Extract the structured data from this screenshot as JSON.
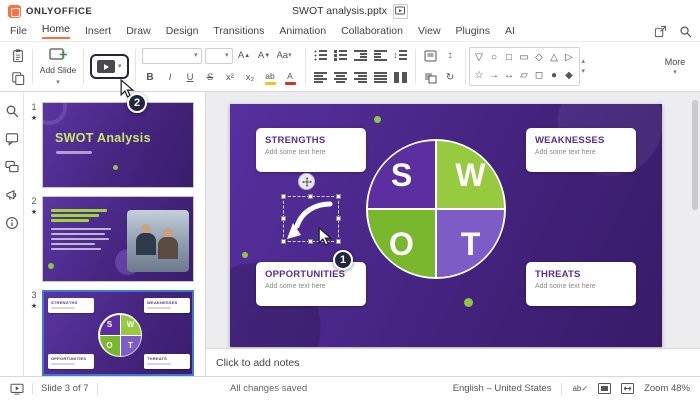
{
  "titlebar": {
    "app_name": "ONLYOFFICE",
    "doc_title": "SWOT analysis.pptx"
  },
  "menubar": {
    "items": [
      "File",
      "Home",
      "Insert",
      "Draw",
      "Design",
      "Transitions",
      "Animation",
      "Collaboration",
      "View",
      "Plugins",
      "AI"
    ]
  },
  "toolbar": {
    "add_slide_label": "Add Slide",
    "more_label": "More",
    "bold": "B",
    "italic": "I",
    "underline": "U",
    "strike": "S",
    "superscript": "x²",
    "subscript": "x₂",
    "highlight_label": "ab",
    "font_color_label": "A",
    "inc_font_label": "A",
    "dec_font_label": "A",
    "case_label": "Aa",
    "shapes": [
      "▽",
      "○",
      "□",
      "▭",
      "◇",
      "△",
      "▷",
      "☆",
      "→",
      "↔",
      "▱",
      "◻",
      "●",
      "◆"
    ]
  },
  "icons": {
    "chevron": "▾",
    "star": "★",
    "spell": "ab✓",
    "scroll_up": "▴",
    "scroll_down": "▾",
    "tri_up": "▲",
    "tri_down": "▼",
    "updown": "↕",
    "rotate": "↻"
  },
  "slides_panel": {
    "slides": [
      {
        "number": "1",
        "title": "SWOT Analysis"
      },
      {
        "number": "2"
      },
      {
        "number": "3"
      }
    ]
  },
  "slide": {
    "cards": [
      {
        "title": "STRENGTHS",
        "body": "Add some text here"
      },
      {
        "title": "WEAKNESSES",
        "body": "Add some text here"
      },
      {
        "title": "OPPORTUNITIES",
        "body": "Add some text here"
      },
      {
        "title": "THREATS",
        "body": "Add some text here"
      }
    ],
    "letters": [
      "S",
      "W",
      "O",
      "T"
    ]
  },
  "notes": {
    "placeholder": "Click to add notes"
  },
  "statusbar": {
    "slide_info": "Slide 3 of 7",
    "save_status": "All changes saved",
    "language": "English – United States",
    "zoom": "Zoom 48%"
  },
  "annotations": {
    "step1": "1",
    "step2": "2"
  },
  "colors": {
    "accent_orange": "#ff6f3d",
    "slide_purple": "#46257f",
    "quad_purple": "#5b2f9f",
    "quad_purple_light": "#7e5cc6",
    "quad_green": "#97ca3e",
    "quad_green_dark": "#79b82d",
    "selection_blue": "#3b7ad9",
    "badge_navy": "#20263d"
  }
}
